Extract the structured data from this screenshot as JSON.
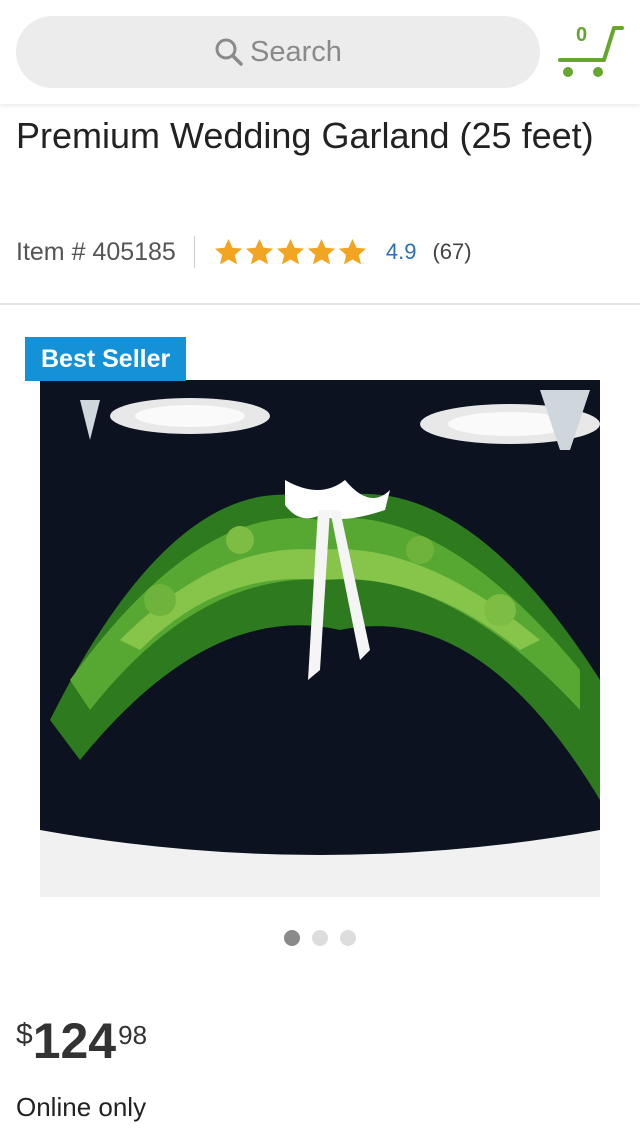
{
  "search": {
    "placeholder": "Search"
  },
  "cart": {
    "count": "0"
  },
  "product": {
    "title": "Premium Wedding Garland (25 feet)",
    "item_number": "Item # 405185",
    "rating": "4.9",
    "review_count": "(67)",
    "stars": 5,
    "badge": "Best Seller",
    "price": {
      "symbol": "$",
      "dollars": "124",
      "cents": "98"
    },
    "availability": "Online only"
  },
  "carousel": {
    "total": 3,
    "active": 1
  },
  "colors": {
    "accent_green": "#66a62f",
    "badge_blue": "#1591d7",
    "star_gold": "#f2a523",
    "link_blue": "#2a6ebb"
  }
}
